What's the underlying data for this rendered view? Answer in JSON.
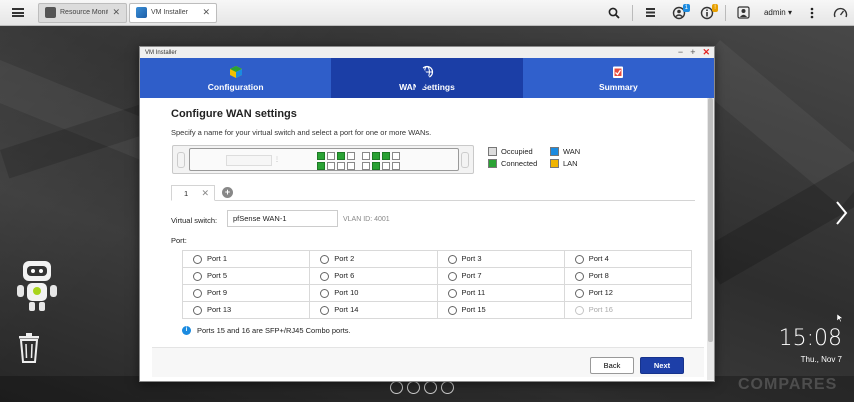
{
  "taskbar": {
    "tabs": [
      {
        "label": "Resource Monit...",
        "icon": "resource-monitor-icon"
      },
      {
        "label": "VM Installer",
        "icon": "vm-installer-icon"
      }
    ],
    "user": "admin",
    "notification_count": "1",
    "alert_badge": "!"
  },
  "window": {
    "title": "VM Installer",
    "steps": [
      {
        "label": "Configuration",
        "icon": "cube-icon"
      },
      {
        "label": "WAN Settings",
        "icon": "globe-icon"
      },
      {
        "label": "Summary",
        "icon": "clipboard-icon"
      }
    ],
    "active_step": "WAN Settings"
  },
  "wan": {
    "heading": "Configure WAN settings",
    "description": "Specify a name for your virtual switch and select a port for one or more WANs.",
    "legend": {
      "occupied": "Occupied",
      "connected": "Connected",
      "wan": "WAN",
      "lan": "LAN"
    },
    "tab_label": "1",
    "virtual_switch_label": "Virtual switch:",
    "virtual_switch_value": "pfSense WAN-1",
    "vlan": "VLAN ID: 4001",
    "port_label": "Port:",
    "ports": [
      [
        "Port 1",
        "Port 2",
        "Port 3",
        "Port 4"
      ],
      [
        "Port 5",
        "Port 6",
        "Port 7",
        "Port 8"
      ],
      [
        "Port 9",
        "Port 10",
        "Port 11",
        "Port 12"
      ],
      [
        "Port 13",
        "Port 14",
        "Port 15",
        "Port 16"
      ]
    ],
    "disabled_port": "Port 16",
    "note": "Ports 15 and 16 are SFP+/RJ45 Combo ports."
  },
  "buttons": {
    "back": "Back",
    "next": "Next"
  },
  "desktop": {
    "time": "15:08",
    "date": "Thu., Nov 7",
    "watermark": "COMPARES"
  },
  "colors": {
    "accent": "#1d3fa8",
    "wan": "#1b8be0",
    "lan": "#f0b400",
    "connected": "#2aa234"
  }
}
